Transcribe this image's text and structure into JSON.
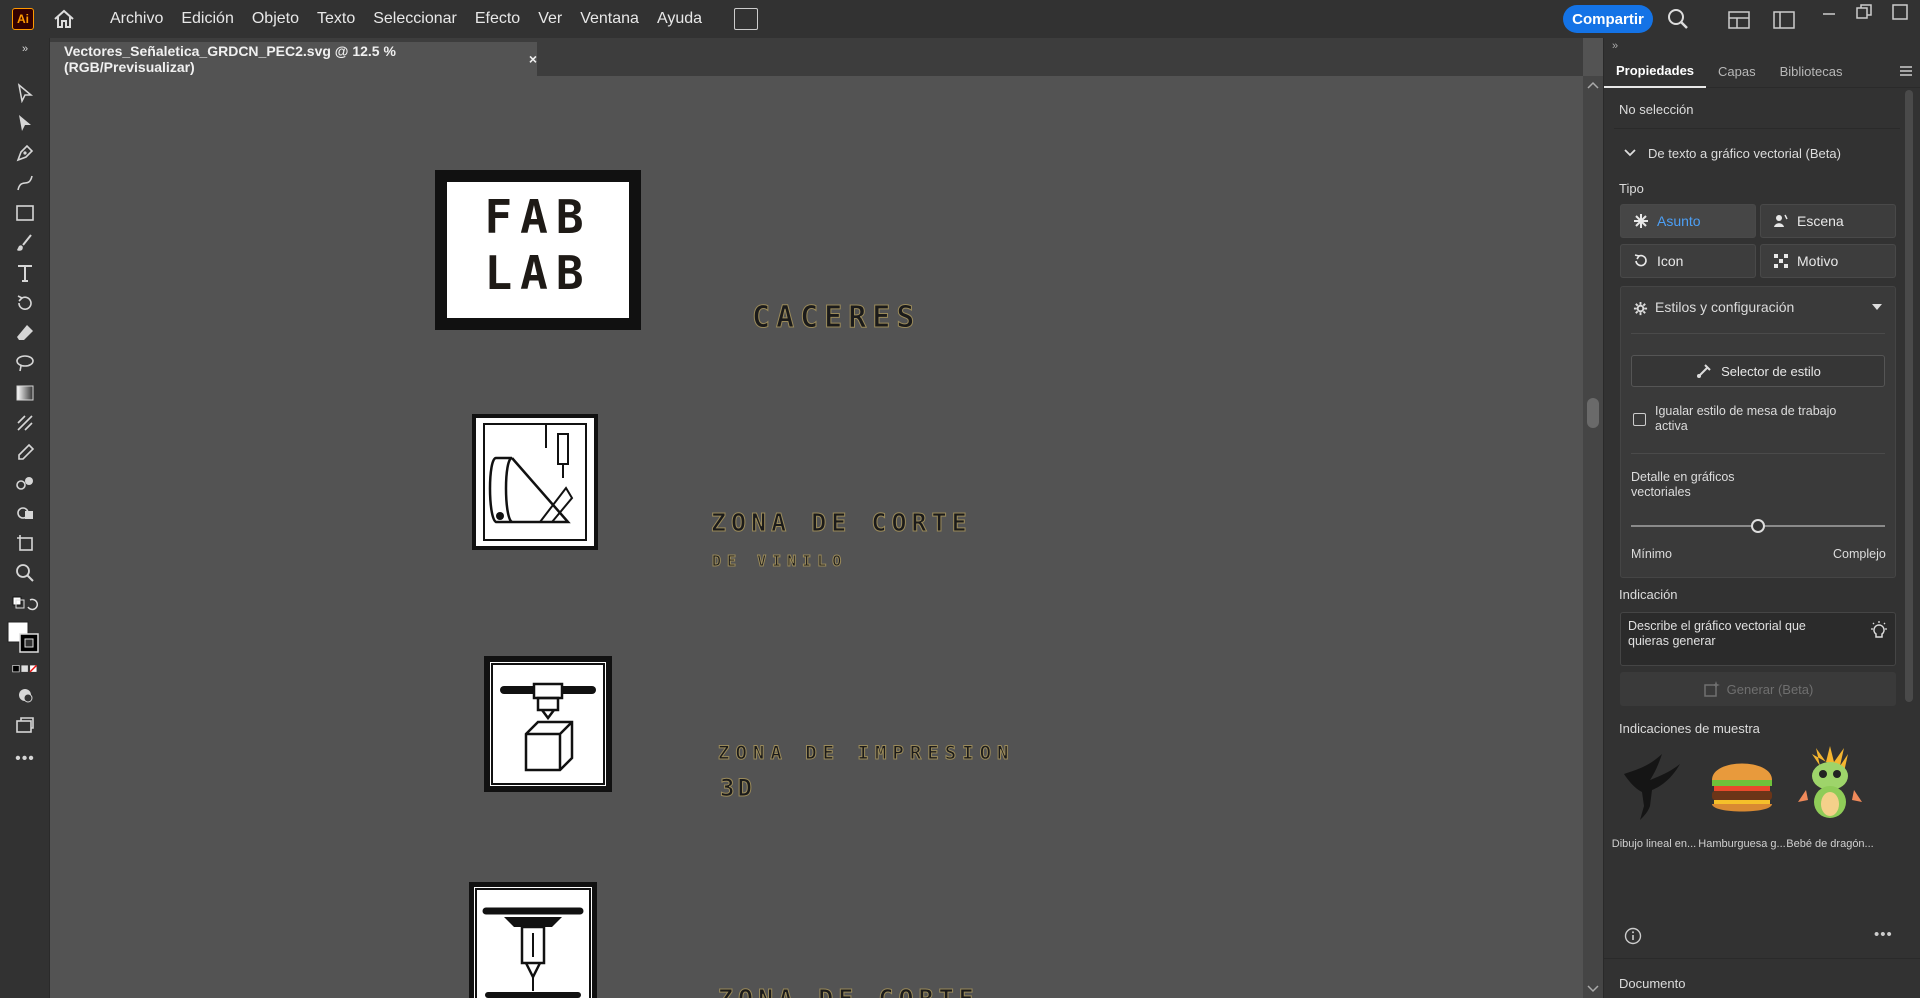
{
  "app": {
    "logo": "Ai",
    "share_label": "Compartir"
  },
  "menu": [
    "Archivo",
    "Edición",
    "Objeto",
    "Texto",
    "Seleccionar",
    "Efecto",
    "Ver",
    "Ventana",
    "Ayuda"
  ],
  "document_tab": {
    "title": "Vectores_Señaletica_GRDCN_PEC2.svg @ 12.5 % (RGB/Previsualizar)",
    "close": "×"
  },
  "artboard": {
    "fablab_top": "FAB",
    "fablab_bottom": "LAB",
    "caceres": "CACERES",
    "vinyl_title": "ZONA DE CORTE",
    "vinyl_sub": "DE VINILO",
    "print_title": "ZONA DE IMPRESION",
    "print_sub": "3D",
    "laser_title": "ZONA DE CORTE"
  },
  "panel": {
    "tabs": [
      "Propiedades",
      "Capas",
      "Bibliotecas"
    ],
    "no_selection": "No selección",
    "section_title": "De texto a gráfico vectorial (Beta)",
    "type_label": "Tipo",
    "type_buttons": [
      "Asunto",
      "Escena",
      "Icon",
      "Motivo"
    ],
    "styles_title": "Estilos y configuración",
    "style_selector": "Selector de estilo",
    "match_style": "Igualar estilo de mesa de trabajo activa",
    "detail_label": "Detalle en gráficos vectoriales",
    "detail_min": "Mínimo",
    "detail_max": "Complejo",
    "detail_value": 0.5,
    "prompt_label": "Indicación",
    "prompt_placeholder": "Describe el gráfico vectorial que quieras generar",
    "generate": "Generar (Beta)",
    "samples_label": "Indicaciones de muestra",
    "samples": [
      "Dibujo lineal en...",
      "Hamburguesa g...",
      "Bebé de dragón..."
    ],
    "document_label": "Documento"
  },
  "colors": {
    "accent": "#1473e6",
    "selected_text": "#4c9ff5"
  }
}
